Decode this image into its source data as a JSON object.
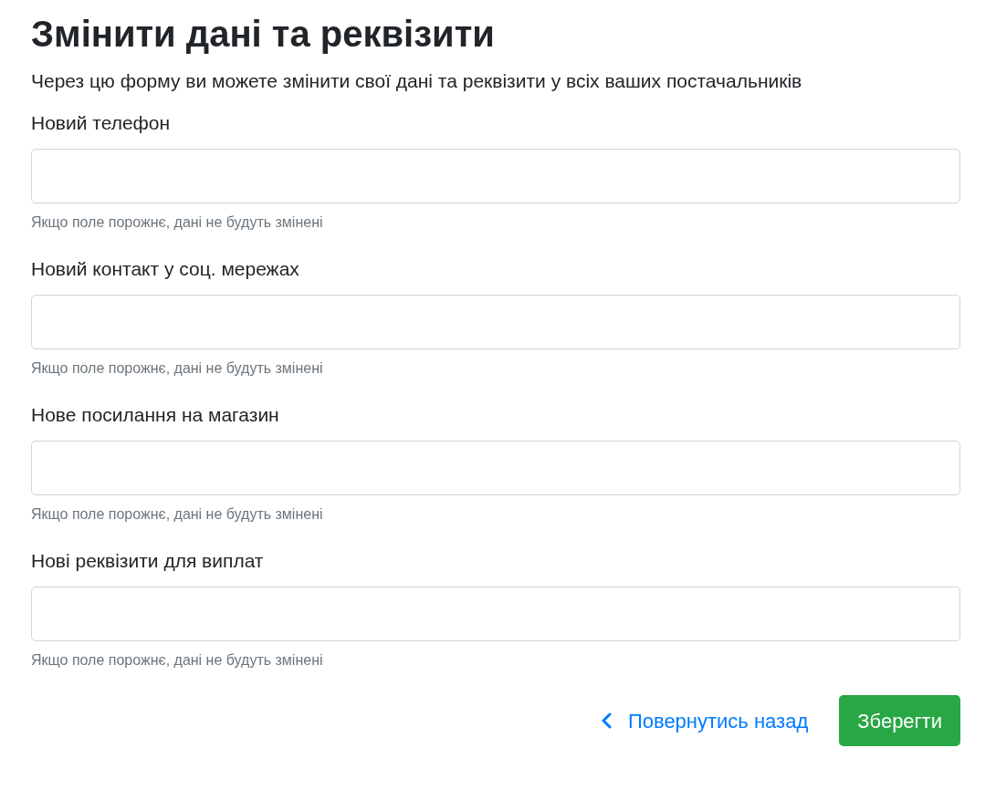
{
  "title": "Змінити дані та реквізити",
  "subtitle": "Через цю форму ви можете змінити свої дані та реквізити у всіх ваших постачальників",
  "fields": [
    {
      "label": "Новий телефон",
      "hint": "Якщо поле порожнє, дані не будуть змінені"
    },
    {
      "label": "Новий контакт у соц. мережах",
      "hint": "Якщо поле порожнє, дані не будуть змінені"
    },
    {
      "label": "Нове посилання на магазин",
      "hint": "Якщо поле порожнє, дані не будуть змінені"
    },
    {
      "label": "Нові реквізити для виплат",
      "hint": "Якщо поле порожнє, дані не будуть змінені"
    }
  ],
  "back_link": "Повернутись назад",
  "save_button": "Зберегти"
}
